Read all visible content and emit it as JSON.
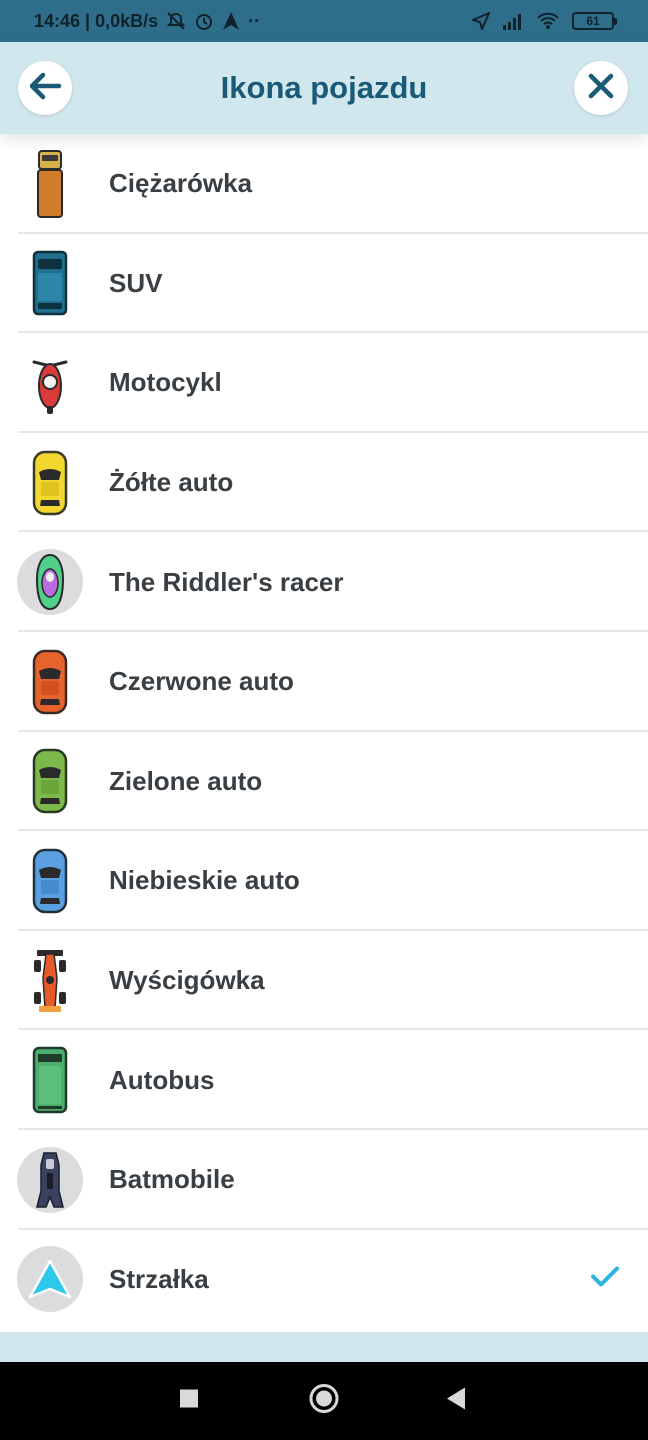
{
  "status_bar": {
    "time_speed": "14:46 | 0,0kB/s",
    "dots": "··",
    "battery": "61"
  },
  "header": {
    "title": "Ikona pojazdu"
  },
  "vehicles": [
    {
      "label": "Ciężarówka",
      "icon": "truck-icon"
    },
    {
      "label": "SUV",
      "icon": "suv-icon"
    },
    {
      "label": "Motocykl",
      "icon": "motorcycle-icon"
    },
    {
      "label": "Żółte auto",
      "icon": "yellow-car-icon"
    },
    {
      "label": "The Riddler's racer",
      "icon": "riddler-racer-icon"
    },
    {
      "label": "Czerwone auto",
      "icon": "red-car-icon"
    },
    {
      "label": "Zielone auto",
      "icon": "green-car-icon"
    },
    {
      "label": "Niebieskie auto",
      "icon": "blue-car-icon"
    },
    {
      "label": "Wyścigówka",
      "icon": "race-car-icon"
    },
    {
      "label": "Autobus",
      "icon": "bus-icon"
    },
    {
      "label": "Batmobile",
      "icon": "batmobile-icon"
    },
    {
      "label": "Strzałka",
      "icon": "arrow-icon",
      "selected": true
    }
  ],
  "colors": {
    "header_bg": "#d1e7ee",
    "title": "#1a5a76",
    "status_bar": "#2e6e8a",
    "check": "#2db3e0"
  }
}
